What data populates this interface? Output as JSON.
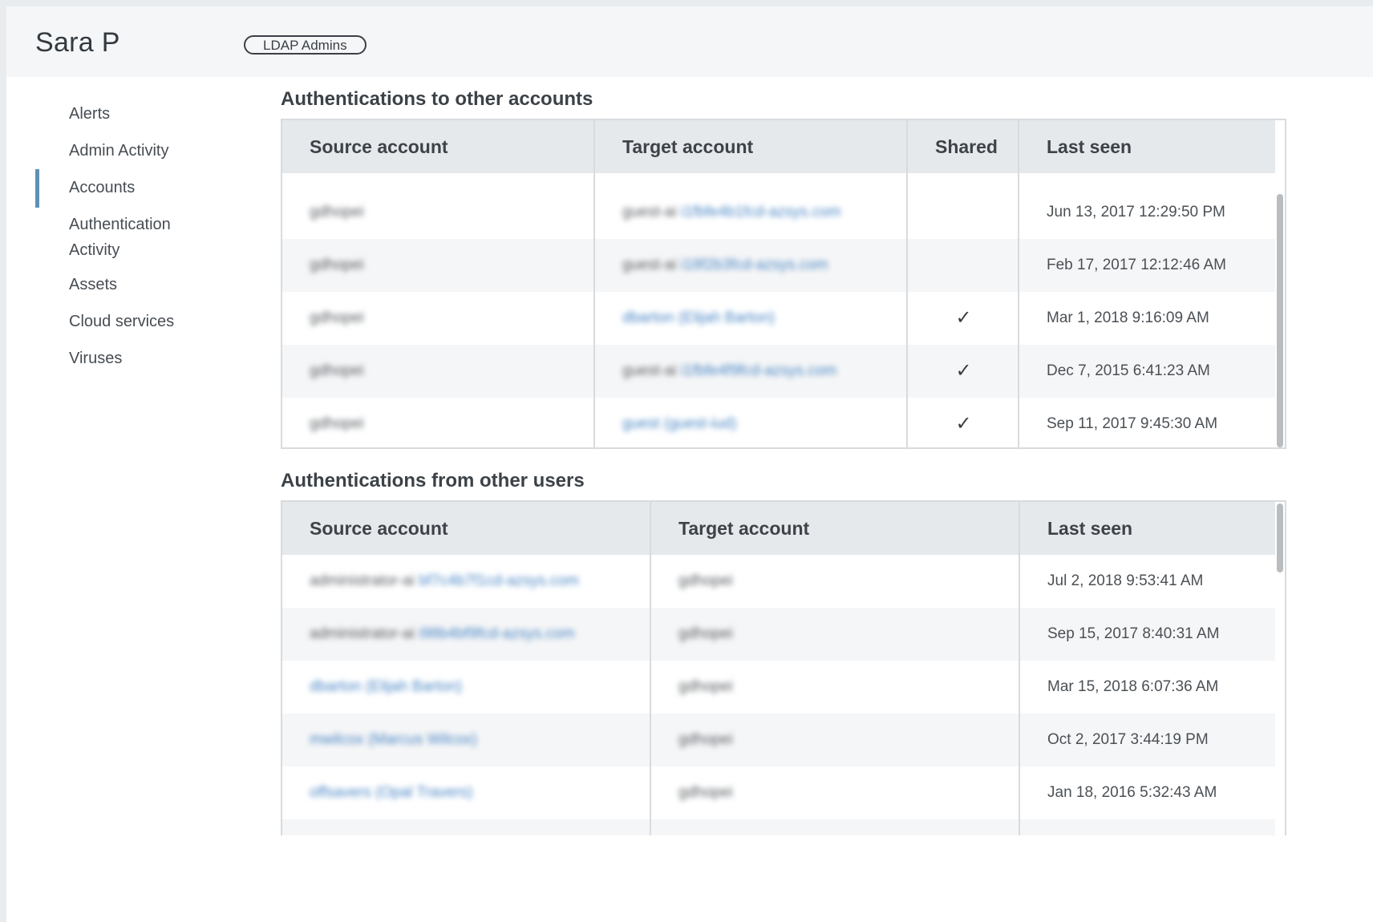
{
  "header": {
    "user_name": "Sara P",
    "group_badge": "LDAP Admins"
  },
  "sidebar": {
    "items": [
      {
        "label": "Alerts",
        "active": false
      },
      {
        "label": "Admin Activity",
        "active": false
      },
      {
        "label": "Accounts",
        "active": true
      },
      {
        "label": "Authentication Activity",
        "active": false
      },
      {
        "label": "Assets",
        "active": false
      },
      {
        "label": "Cloud services",
        "active": false
      },
      {
        "label": "Viruses",
        "active": false
      }
    ]
  },
  "auth_to_other": {
    "title": "Authentications to other accounts",
    "columns": [
      "Source account",
      "Target account",
      "Shared",
      "Last seen"
    ],
    "rows": [
      {
        "source": "gdhopei",
        "target_prefix": "guest-ai ",
        "target_link": "i1fbfe4b1fcd-azsys.com",
        "shared": "",
        "last_seen": "Jun 13, 2017 12:29:50 PM"
      },
      {
        "source": "gdhopei",
        "target_prefix": "guest-ai ",
        "target_link": "i18f2b3fcd-azsys.com",
        "shared": "",
        "last_seen": "Feb 17, 2017 12:12:46 AM"
      },
      {
        "source": "gdhopei",
        "target_prefix": "",
        "target_link": "dbarton (Elijah Barton)",
        "shared": "✓",
        "last_seen": "Mar 1, 2018 9:16:09 AM"
      },
      {
        "source": "gdhopei",
        "target_prefix": "guest-ai ",
        "target_link": "i1fbfe4f9fcd-azsys.com",
        "shared": "✓",
        "last_seen": "Dec 7, 2015 6:41:23 AM"
      },
      {
        "source": "gdhopei",
        "target_prefix": "",
        "target_link": "guest (guest-iud)",
        "shared": "✓",
        "last_seen": "Sep 11, 2017 9:45:30 AM"
      }
    ]
  },
  "auth_from_other": {
    "title": "Authentications from other users",
    "columns": [
      "Source account",
      "Target account",
      "Last seen"
    ],
    "rows": [
      {
        "source_prefix": "administrator-ai ",
        "source_link": "bf7c4b7f1cd-azsys.com",
        "target": "gdhopei",
        "last_seen": "Jul 2, 2018 9:53:41 AM"
      },
      {
        "source_prefix": "administrator-ai ",
        "source_link": "i98b4bf9fcd-azsys.com",
        "target": "gdhopei",
        "last_seen": "Sep 15, 2017 8:40:31 AM"
      },
      {
        "source_prefix": "",
        "source_link": "dbarton (Elijah Barton)",
        "target": "gdhopei",
        "last_seen": "Mar 15, 2018 6:07:36 AM"
      },
      {
        "source_prefix": "",
        "source_link": "mwilcox (Marcus Wilcox)",
        "target": "gdhopei",
        "last_seen": "Oct 2, 2017 3:44:19 PM"
      },
      {
        "source_prefix": "",
        "source_link": "offsavers (Opal Travers)",
        "target": "gdhopei",
        "last_seen": "Jan 18, 2016 5:32:43 AM"
      }
    ]
  }
}
